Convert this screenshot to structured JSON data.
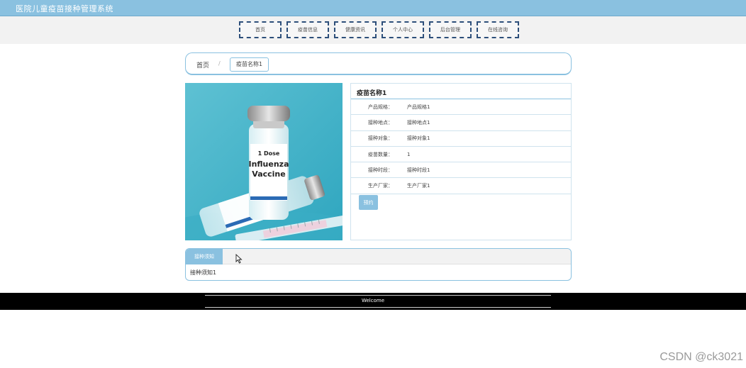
{
  "app": {
    "title": "医院儿童疫苗接种管理系统"
  },
  "nav": {
    "items": [
      "首页",
      "疫苗信息",
      "健康资讯",
      "个人中心",
      "后台管理",
      "在线咨询"
    ]
  },
  "breadcrumb": {
    "home": "首页",
    "separator": "/",
    "current": "疫苗名称1"
  },
  "image": {
    "line1": "1 Dose",
    "line2": "Influenza",
    "line3": "Vaccine"
  },
  "detail": {
    "title": "疫苗名称1",
    "rows": [
      {
        "label": "产品规格：",
        "value": "产品规格1"
      },
      {
        "label": "接种地点：",
        "value": "接种地点1"
      },
      {
        "label": "接种对象：",
        "value": "接种对象1"
      },
      {
        "label": "疫苗数量：",
        "value": "1"
      },
      {
        "label": "接种时段：",
        "value": "接种时段1"
      },
      {
        "label": "生产厂家：",
        "value": "生产厂家1"
      }
    ],
    "action_label": "预约"
  },
  "tabs": {
    "active_label": "接种须知",
    "content": "接种须知1"
  },
  "footer": {
    "text": "Welcome"
  },
  "watermark": "CSDN @ck3021",
  "colors": {
    "accent": "#8ac1e0",
    "nav_border": "#2d4f7a",
    "footer_bg": "#000000"
  }
}
